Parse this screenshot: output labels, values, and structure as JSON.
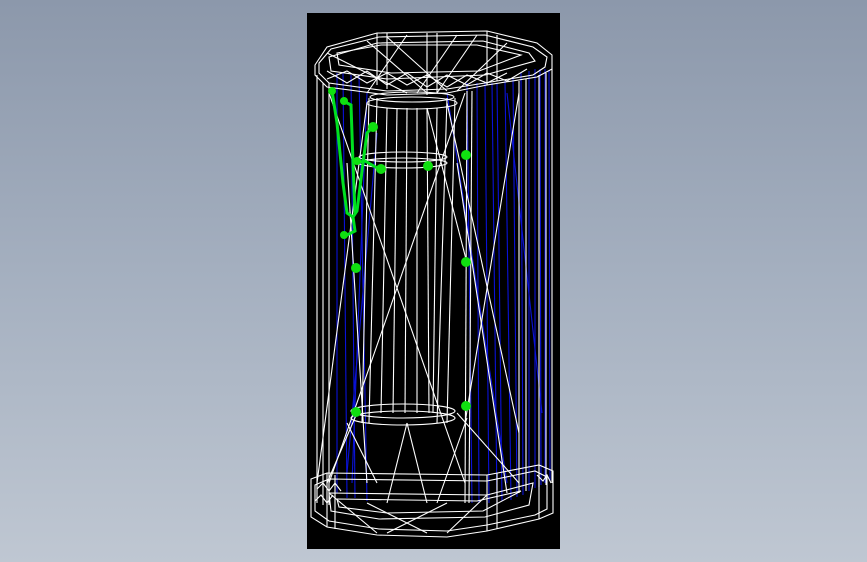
{
  "viewport": {
    "background_top": "#8c98ab",
    "background_bottom": "#bfc7d2",
    "canvas_color": "#000000"
  },
  "model": {
    "wire_color": "#ffffff",
    "hidden_wire_color": "#0000cc",
    "feature_color": "#00e000",
    "description_icon": "wireframe-cabinet"
  }
}
